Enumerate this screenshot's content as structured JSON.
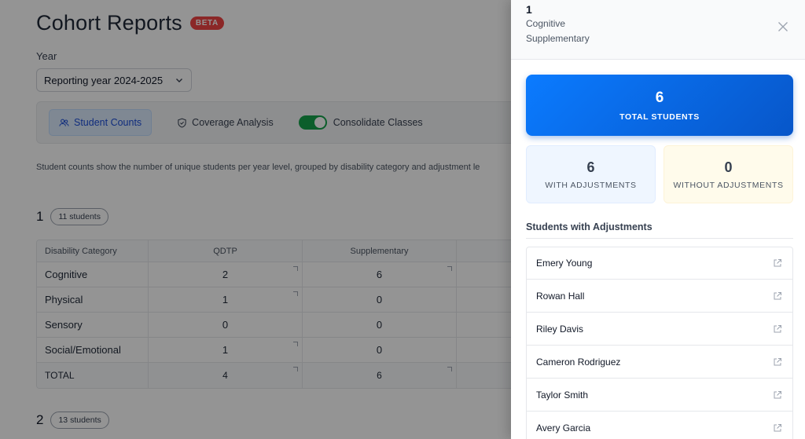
{
  "page": {
    "title": "Cohort Reports",
    "beta_badge": "BETA",
    "year_label": "Year",
    "year_select_value": "Reporting year 2024-2025",
    "tabs": [
      {
        "label": "Student Counts",
        "icon": "users-icon",
        "active": true
      },
      {
        "label": "Coverage Analysis",
        "icon": "shield-icon",
        "active": false
      }
    ],
    "consolidate_toggle": {
      "label": "Consolidate Classes",
      "on": true
    },
    "description": "Student counts show the number of unique students per year level, grouped by disability category and adjustment le",
    "year_groups": [
      {
        "level": "1",
        "count_label": "11 students"
      },
      {
        "level": "2",
        "count_label": "13 students"
      }
    ],
    "table": {
      "headers": [
        "Disability Category",
        "QDTP",
        "Supplementary"
      ],
      "rows": [
        {
          "category": "Cognitive",
          "qdtp": "2",
          "supplementary": "6"
        },
        {
          "category": "Physical",
          "qdtp": "1",
          "supplementary": "0"
        },
        {
          "category": "Sensory",
          "qdtp": "0",
          "supplementary": "0"
        },
        {
          "category": "Social/Emotional",
          "qdtp": "1",
          "supplementary": "0"
        },
        {
          "category": "TOTAL",
          "qdtp": "4",
          "supplementary": "6"
        }
      ]
    }
  },
  "panel": {
    "level": "1",
    "category": "Cognitive",
    "adjustment": "Supplementary",
    "total": {
      "value": "6",
      "label": "TOTAL STUDENTS"
    },
    "with_adjustments": {
      "value": "6",
      "label": "WITH ADJUSTMENTS"
    },
    "without_adjustments": {
      "value": "0",
      "label": "WITHOUT ADJUSTMENTS"
    },
    "section_title": "Students with Adjustments",
    "students": [
      "Emery Young",
      "Rowan Hall",
      "Riley Davis",
      "Cameron Rodriguez",
      "Taylor Smith",
      "Avery Garcia"
    ]
  },
  "colors": {
    "accent": "#0b7bff",
    "beta": "#ef4444",
    "toggle_on": "#16a34a"
  }
}
